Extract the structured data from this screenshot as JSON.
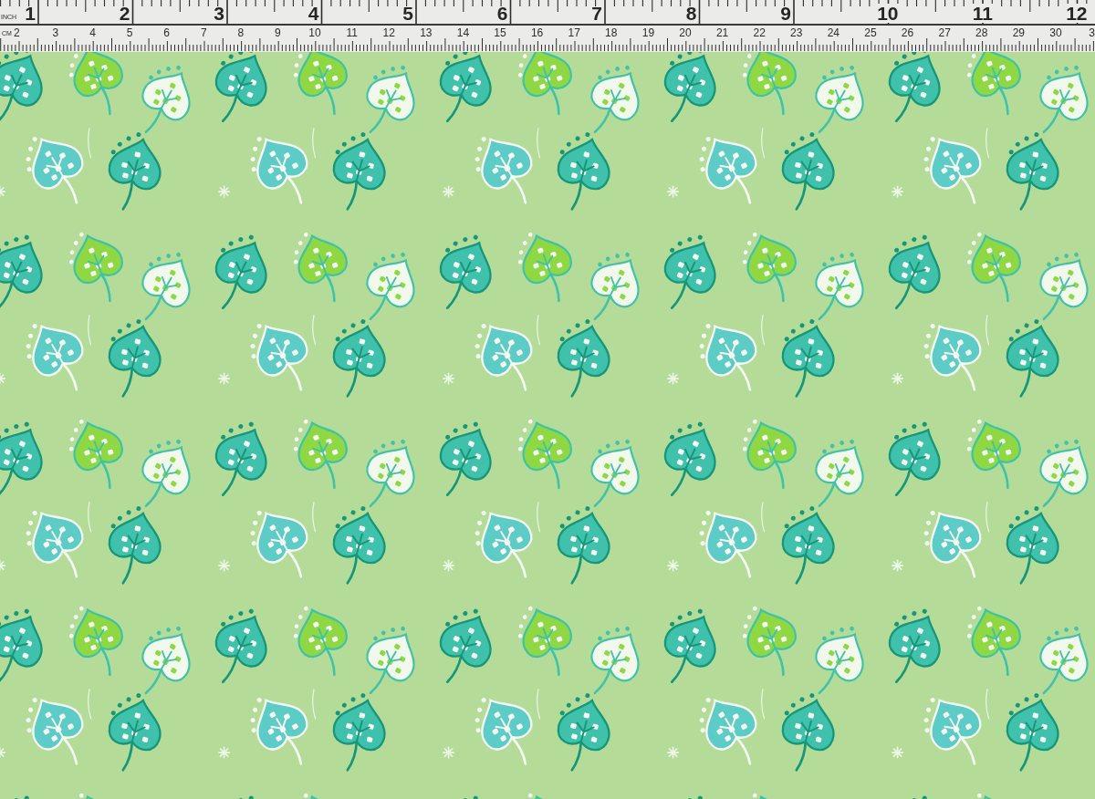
{
  "ruler": {
    "inch_label": "INCH",
    "inch_marks": [
      "1",
      "2",
      "3",
      "4",
      "5",
      "6",
      "7",
      "8",
      "9",
      "10",
      "11",
      "12"
    ],
    "cm_label": "CM",
    "cm_marks": [
      "2",
      "3",
      "4",
      "5",
      "6",
      "7",
      "8",
      "9",
      "10",
      "11",
      "12",
      "13",
      "14",
      "15",
      "16",
      "17",
      "18",
      "19",
      "20",
      "21",
      "22",
      "23",
      "24",
      "25",
      "26",
      "27",
      "28",
      "29",
      "30",
      "3"
    ]
  }
}
